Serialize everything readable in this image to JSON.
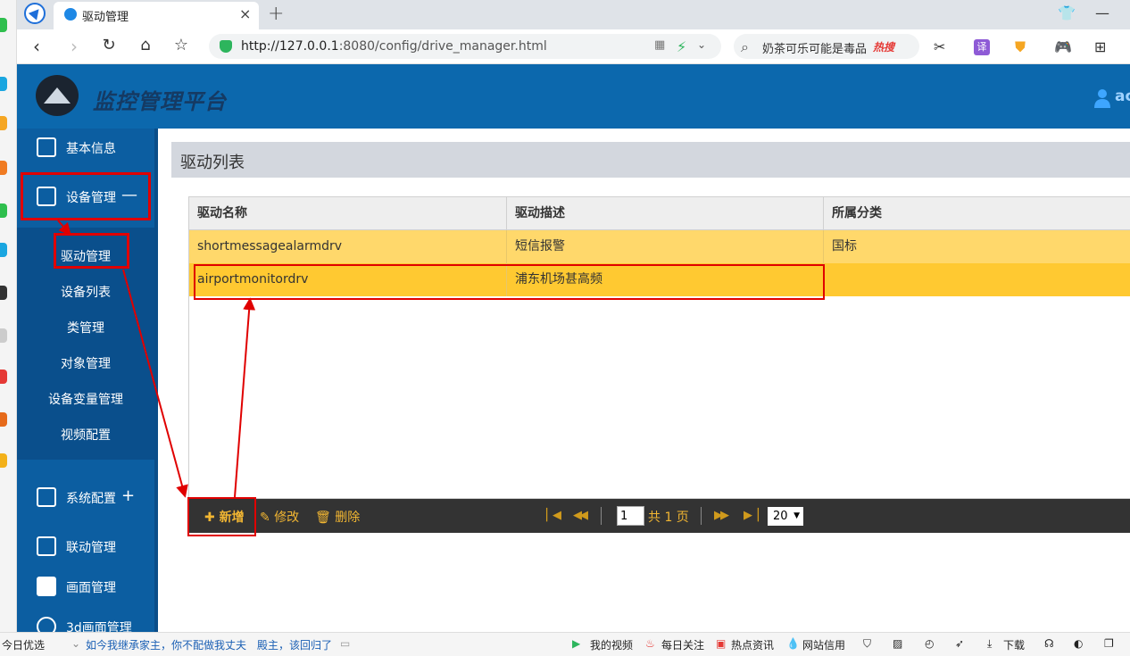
{
  "browser": {
    "tab_title": "驱动管理",
    "tab_close": "×",
    "new_tab": "+",
    "url_host": "http://127.0.0.1",
    "url_rest": ":8080/config/drive_manager.html",
    "search_text": "奶茶可乐可能是毒品",
    "search_badge": "热搜",
    "translate_label": "译"
  },
  "app": {
    "title": "监控管理平台",
    "user_name": "ac"
  },
  "sidebar": {
    "items": [
      {
        "label": "基本信息",
        "sign": ""
      },
      {
        "label": "设备管理",
        "sign": "—"
      },
      {
        "label": "系统配置",
        "sign": "+"
      },
      {
        "label": "联动管理",
        "sign": ""
      },
      {
        "label": "画面管理",
        "sign": ""
      },
      {
        "label": "3d画面管理",
        "sign": ""
      }
    ],
    "sub_items": [
      "驱动管理",
      "设备列表",
      "类管理",
      "对象管理",
      "设备变量管理",
      "视频配置"
    ]
  },
  "list": {
    "title": "驱动列表",
    "columns": [
      "驱动名称",
      "驱动描述",
      "所属分类"
    ],
    "rows": [
      [
        "shortmessagealarmdrv",
        "短信报警",
        "国标"
      ],
      [
        "airportmonitordrv",
        "浦东机场甚高频",
        ""
      ]
    ]
  },
  "pager": {
    "add_label": "新增",
    "edit_label": "修改",
    "delete_label": "删除",
    "page_value": "1",
    "total_text": "共 1 页",
    "page_size": "20"
  },
  "statusbar": {
    "left_label": "今日优选",
    "news_text": "如今我继承家主，你不配做我丈夫",
    "news_text2": "殿主，该回归了",
    "my_video": "我的视频",
    "daily_focus": "每日关注",
    "hot_news": "热点资讯",
    "bank": "网站信用",
    "download": "下载"
  },
  "colors": {
    "header_blue": "#0c68ad",
    "sidebar_blue": "#0c5ea1",
    "row_highlight": "#ffc931",
    "row_normal": "#ffd86b",
    "annotation_red": "#e00000"
  }
}
